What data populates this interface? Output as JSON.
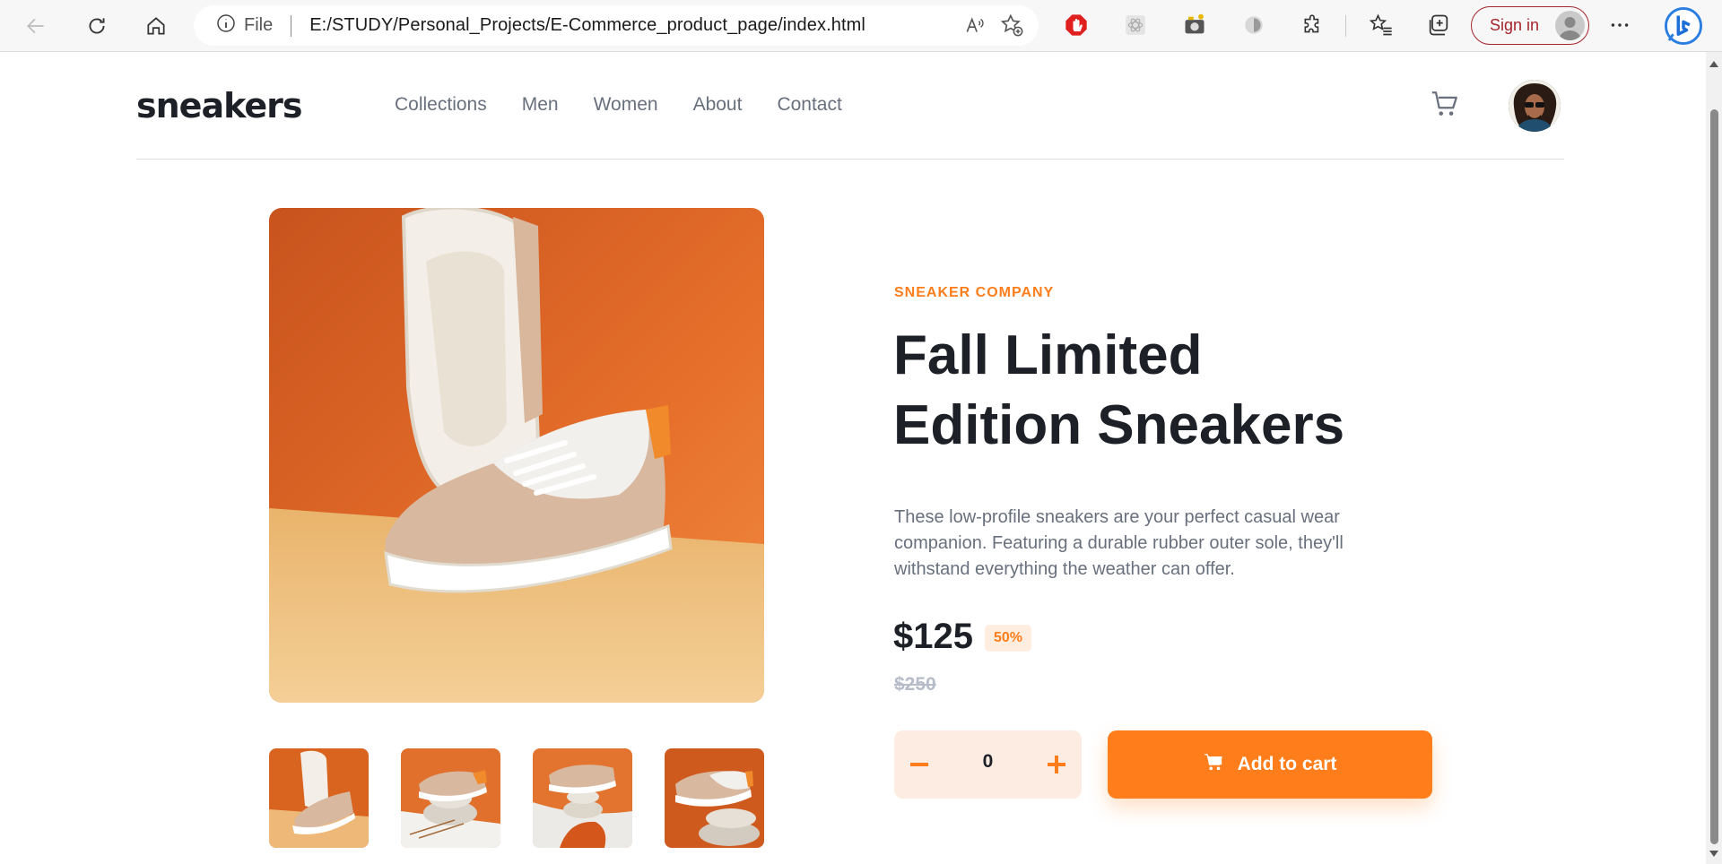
{
  "browser": {
    "file_label": "File",
    "url": "E:/STUDY/Personal_Projects/E-Commerce_product_page/index.html",
    "signin_label": "Sign in"
  },
  "header": {
    "logo": "sneakers",
    "nav": [
      "Collections",
      "Men",
      "Women",
      "About",
      "Contact"
    ]
  },
  "product": {
    "company": "SNEAKER COMPANY",
    "title": "Fall Limited Edition Sneakers",
    "description": "These low-profile sneakers are your perfect casual wear companion. Featuring a durable rubber outer sole, they'll withstand everything the weather can offer.",
    "price": "$125",
    "discount": "50%",
    "old_price": "$250",
    "quantity": "0",
    "add_to_cart": "Add to cart"
  },
  "colors": {
    "accent": "#ff7e1b",
    "accent_pale": "#ffede0",
    "dark": "#1d2026",
    "gray": "#69707d",
    "light_gray": "#b6bcc8"
  }
}
